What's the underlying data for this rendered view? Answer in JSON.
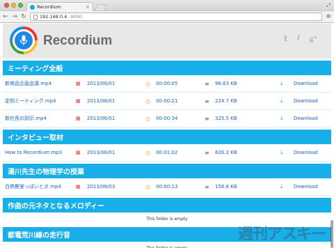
{
  "browser": {
    "tab_title": "Recordium",
    "url_host": "192.168.0.4",
    "url_port": ":9090"
  },
  "header": {
    "brand": "Recordium",
    "social": [
      "twitter-icon",
      "facebook-icon",
      "google-plus-icon"
    ],
    "social_glyphs": [
      "𝕥",
      "f",
      "g⁺"
    ]
  },
  "sections": [
    {
      "title": "ミーティング全般",
      "files": [
        {
          "name": "新商品企画会議.mp4",
          "date": "2013/06/01",
          "duration": "00:00:05",
          "size": "96.63 KB",
          "download": "Download"
        },
        {
          "name": "定例ミーティング.mp4",
          "date": "2013/06/01",
          "duration": "00:00:21",
          "size": "224.7 KB",
          "download": "Download"
        },
        {
          "name": "新社長の訓示.mp4",
          "date": "2013/06/01",
          "duration": "00:00:34",
          "size": "325.5 KB",
          "download": "Download"
        }
      ]
    },
    {
      "title": "インタビュー取材",
      "files": [
        {
          "name": "How to Recordium.mp3",
          "date": "2013/06/01",
          "duration": "00:01:02",
          "size": "626.2 KB",
          "download": "Download"
        }
      ]
    },
    {
      "title": "湯川先生の物理学の授業",
      "files": [
        {
          "name": "白熱教室っぽいとき.mp4",
          "date": "2013/06/03",
          "duration": "00:00:13",
          "size": "156.6 KB",
          "download": "Download"
        }
      ]
    },
    {
      "title": "作曲の元ネタとなるメロディー",
      "files": [],
      "empty": "This folder is empty"
    },
    {
      "title": "都電荒川線の走行音",
      "files": [],
      "empty": "This folder is empty"
    }
  ],
  "watermark": "週刊アスキー",
  "colors": {
    "accent": "#18aee8",
    "link": "#1565c0",
    "header_bg": "#e8e8e8"
  }
}
